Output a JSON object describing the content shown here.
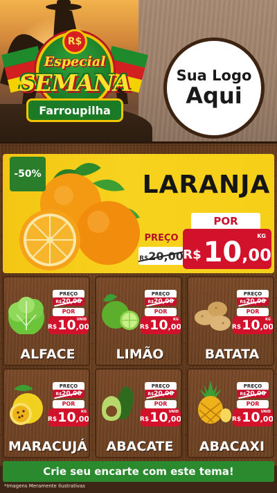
{
  "header": {
    "badge": {
      "currency_symbol": "R$",
      "line1": "Especial",
      "line2": "SEMANA",
      "line3": "Farroupilha"
    },
    "logo_placeholder": {
      "line1": "Sua Logo",
      "line2": "Aqui"
    }
  },
  "featured": {
    "discount": "-50%",
    "name": "LARANJA",
    "old_price_label": "PREÇO",
    "old_price_currency": "R$",
    "old_price_value": "20,00",
    "new_price_label": "POR",
    "new_price_currency": "R$",
    "new_price_int": "10",
    "new_price_dec": ",00",
    "unit": "KG",
    "icon": "orange-fruit-icon"
  },
  "products": [
    {
      "name": "ALFACE",
      "old_label": "PREÇO",
      "old_currency": "R$",
      "old_value": "20,00",
      "new_label": "POR",
      "new_currency": "R$",
      "new_int": "10",
      "new_dec": ",00",
      "unit": "UNID",
      "icon": "lettuce-icon"
    },
    {
      "name": "LIMÃO",
      "old_label": "PREÇO",
      "old_currency": "R$",
      "old_value": "20,00",
      "new_label": "POR",
      "new_currency": "R$",
      "new_int": "10",
      "new_dec": ",00",
      "unit": "KG",
      "icon": "lime-icon"
    },
    {
      "name": "BATATA",
      "old_label": "PREÇO",
      "old_currency": "R$",
      "old_value": "20,00",
      "new_label": "POR",
      "new_currency": "R$",
      "new_int": "10",
      "new_dec": ",00",
      "unit": "KG",
      "icon": "potato-icon"
    },
    {
      "name": "MARACUJÁ",
      "old_label": "PREÇO",
      "old_currency": "R$",
      "old_value": "20,00",
      "new_label": "POR",
      "new_currency": "R$",
      "new_int": "10",
      "new_dec": ",00",
      "unit": "KG",
      "icon": "passion-fruit-icon"
    },
    {
      "name": "ABACATE",
      "old_label": "PREÇO",
      "old_currency": "R$",
      "old_value": "20,00",
      "new_label": "POR",
      "new_currency": "R$",
      "new_int": "10",
      "new_dec": ",00",
      "unit": "UNID",
      "icon": "avocado-icon"
    },
    {
      "name": "ABACAXI",
      "old_label": "PREÇO",
      "old_currency": "R$",
      "old_value": "20,00",
      "new_label": "POR",
      "new_currency": "R$",
      "new_int": "10",
      "new_dec": ",00",
      "unit": "UNID",
      "icon": "pineapple-icon"
    }
  ],
  "footer": {
    "cta": "Crie seu encarte com este tema!",
    "note": "*Imagens Meramente Ilustrativas"
  },
  "colors": {
    "featured_bg": "#f6cf17",
    "price_red": "#d2112b",
    "discount_green": "#2a7d2a",
    "cta_green": "#2a8a2d",
    "wood": "#6a3f1f"
  }
}
